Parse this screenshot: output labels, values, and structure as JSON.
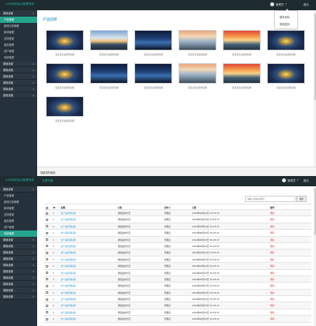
{
  "app": {
    "brand": "XXX网站后台管理系统",
    "user": "管理员",
    "exit": "退出",
    "footer": "感谢您的使用"
  },
  "screen1": {
    "sidebar": [
      {
        "type": "group",
        "label": "基础设置"
      },
      {
        "type": "item",
        "label": "产品管理",
        "active": true
      },
      {
        "type": "item",
        "label": "新闻分类管理"
      },
      {
        "type": "item",
        "label": "新闻管理"
      },
      {
        "type": "item",
        "label": "友情链接"
      },
      {
        "type": "item",
        "label": "留言管理"
      },
      {
        "type": "item",
        "label": "用户管理"
      },
      {
        "type": "item",
        "label": "系统管理"
      },
      {
        "type": "group",
        "label": "基础设置"
      },
      {
        "type": "group",
        "label": "基础设置"
      },
      {
        "type": "group",
        "label": "基础设置"
      },
      {
        "type": "group",
        "label": "基础设置"
      },
      {
        "type": "group",
        "label": "基础设置"
      },
      {
        "type": "group",
        "label": "基础设置"
      }
    ],
    "section_title": "产品图库",
    "dropdown": [
      "基本资料",
      "修改密码"
    ],
    "caption": "某某某企业新闻标题",
    "gallery": [
      {
        "scene": "tunnel"
      },
      {
        "scene": "sunset"
      },
      {
        "scene": "city"
      },
      {
        "scene": "mist"
      },
      {
        "scene": "sunset2"
      },
      {
        "scene": "tunnel"
      },
      {
        "scene": "tunnel"
      },
      {
        "scene": "city"
      },
      {
        "scene": "city"
      },
      {
        "scene": "mist"
      },
      {
        "scene": "sunset2"
      },
      {
        "scene": "tunnel"
      },
      {
        "scene": "tunnel"
      }
    ]
  },
  "screen2": {
    "tab": "文章列表",
    "sidebar": [
      {
        "type": "group",
        "label": "基础设置"
      },
      {
        "type": "item",
        "label": "产品管理"
      },
      {
        "type": "item",
        "label": "新闻分类管理"
      },
      {
        "type": "item",
        "label": "新闻管理"
      },
      {
        "type": "item",
        "label": "友情链接"
      },
      {
        "type": "item",
        "label": "留言管理"
      },
      {
        "type": "item",
        "label": "用户管理"
      },
      {
        "type": "item",
        "label": "系统管理",
        "active": true
      },
      {
        "type": "group",
        "label": "基础设置"
      },
      {
        "type": "group",
        "label": "基础设置"
      },
      {
        "type": "group",
        "label": "基础设置"
      },
      {
        "type": "group",
        "label": "基础设置"
      },
      {
        "type": "group",
        "label": "基础设置"
      },
      {
        "type": "group",
        "label": "基础设置"
      },
      {
        "type": "group",
        "label": "基础设置"
      },
      {
        "type": "group",
        "label": "基础设置"
      },
      {
        "type": "group",
        "label": "基础设置"
      },
      {
        "type": "group",
        "label": "基础设置"
      }
    ],
    "search_placeholder": "请输入搜索关键词",
    "search_button": "搜索",
    "columns": [
      "ID",
      "标题",
      "分类",
      "发布人",
      "日期",
      "操作"
    ],
    "rows": [
      {
        "id": "1",
        "title": "这个是新闻标题",
        "category": "通知发布栏目",
        "author": "管理员",
        "date": "2014年08月13日 15:23:47",
        "action": "删除"
      },
      {
        "id": "1",
        "title": "这个是新闻标题",
        "category": "通知发布栏目",
        "author": "管理员",
        "date": "2014年08月13日 15:23:47",
        "action": "删除"
      },
      {
        "id": "1",
        "title": "这个是新闻标题",
        "category": "通知发布栏目",
        "author": "管理员",
        "date": "2014年08月13日 15:23:47",
        "action": "删除"
      },
      {
        "id": "1",
        "title": "这个是新闻标题",
        "category": "通知发布栏目",
        "author": "管理员",
        "date": "2014年08月13日 15:23:47",
        "action": "删除"
      },
      {
        "id": "1",
        "title": "这个是新闻标题",
        "category": "通知发布栏目",
        "author": "管理员",
        "date": "2014年08月13日 15:23:47",
        "action": "删除"
      },
      {
        "id": "1",
        "title": "这个是新闻标题",
        "category": "通知发布栏目",
        "author": "管理员",
        "date": "2014年08月13日 15:23:47",
        "action": "删除"
      },
      {
        "id": "1",
        "title": "这个是新闻标题",
        "category": "通知发布栏目",
        "author": "管理员",
        "date": "2014年08月13日 15:23:47",
        "action": "删除"
      },
      {
        "id": "1",
        "title": "这个是新闻标题",
        "category": "通知发布栏目",
        "author": "管理员",
        "date": "2014年08月13日 15:23:47",
        "action": "删除"
      },
      {
        "id": "1",
        "title": "这个是新闻标题",
        "category": "通知发布栏目",
        "author": "管理员",
        "date": "2014年08月13日 15:23:47",
        "action": "删除"
      },
      {
        "id": "1",
        "title": "这个是新闻标题",
        "category": "通知发布栏目",
        "author": "管理员",
        "date": "2014年08月13日 15:23:47",
        "action": "删除"
      },
      {
        "id": "1",
        "title": "这个是新闻标题",
        "category": "通知发布栏目",
        "author": "管理员",
        "date": "2014年08月13日 15:23:47",
        "action": "删除"
      },
      {
        "id": "1",
        "title": "这个是新闻标题",
        "category": "通知发布栏目",
        "author": "管理员",
        "date": "2014年08月13日 15:23:47",
        "action": "删除"
      },
      {
        "id": "1",
        "title": "这个是新闻标题",
        "category": "通知发布栏目",
        "author": "管理员",
        "date": "2014年08月13日 15:23:47",
        "action": "删除"
      },
      {
        "id": "1",
        "title": "这个是新闻标题",
        "category": "通知发布栏目",
        "author": "管理员",
        "date": "2014年08月13日 15:23:47",
        "action": "删除"
      },
      {
        "id": "1",
        "title": "这个是新闻标题",
        "category": "通知发布栏目",
        "author": "管理员",
        "date": "2014年08月13日 15:23:47",
        "action": "删除"
      },
      {
        "id": "1",
        "title": "这个是新闻标题",
        "category": "通知发布栏目",
        "author": "管理员",
        "date": "2014年08月13日 15:23:47",
        "action": "删除"
      },
      {
        "id": "1",
        "title": "这个是新闻标题",
        "category": "通知发布栏目",
        "author": "管理员",
        "date": "2014年08月13日 15:23:47",
        "action": "删除"
      }
    ]
  },
  "colors": {
    "topbar": "#1e2b2f",
    "brand": "#26b3a6",
    "sidebar": "#26323b",
    "active": "#25a48e",
    "link": "#1e8fd0",
    "danger": "#e04a3c"
  }
}
